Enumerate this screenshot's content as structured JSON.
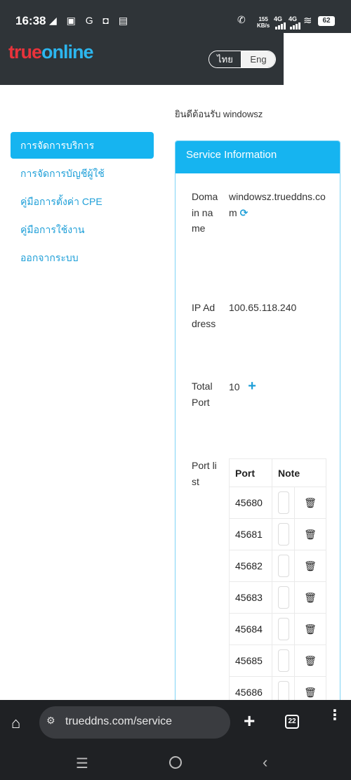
{
  "status_bar": {
    "time": "16:38",
    "left_icons": "◢ ▣ G ◘ ▤",
    "call_icon": "✆",
    "speed_value": "155",
    "speed_unit": "KB/s",
    "net1": "4G",
    "net2": "4G",
    "wifi_icon": "≋",
    "battery": "62"
  },
  "header": {
    "logo_true": "true",
    "logo_online": "online",
    "lang_th": "ไทย",
    "lang_en": "Eng"
  },
  "welcome": "ยินดีต้อนรับ windowsz",
  "sidebar": {
    "items": [
      {
        "label": "การจัดการบริการ"
      },
      {
        "label": "การจัดการบัญชีผู้ใช้"
      },
      {
        "label": "คู่มือการตั้งค่า CPE"
      },
      {
        "label": "คู่มือการใช้งาน"
      },
      {
        "label": "ออกจากระบบ"
      }
    ]
  },
  "card": {
    "title": "Service Information",
    "domain_label": "Domain name",
    "domain_value": "windowsz.trueddns.com",
    "refresh_icon": "⟳",
    "ip_label": "IP Address",
    "ip_value": "100.65.118.240",
    "total_port_label": "Total Port",
    "total_port_value": "10",
    "add_icon": "+",
    "port_list_label": "Port list",
    "table": {
      "col_port": "Port",
      "col_note": "Note",
      "rows": [
        {
          "port": "45680"
        },
        {
          "port": "45681"
        },
        {
          "port": "45682"
        },
        {
          "port": "45683"
        },
        {
          "port": "45684"
        },
        {
          "port": "45685"
        },
        {
          "port": "45686"
        }
      ]
    }
  },
  "browser": {
    "home_icon": "⌂",
    "tune_icon": "⚙",
    "url": "trueddns.com/service",
    "plus_icon": "+",
    "tab_count": "22",
    "menu_icon": "⋮"
  },
  "nav": {
    "menu_icon": "☰",
    "back_icon": "‹"
  },
  "colors": {
    "accent": "#16b4f0",
    "brand_red": "#e8333b",
    "header_bg": "#2f3438"
  }
}
